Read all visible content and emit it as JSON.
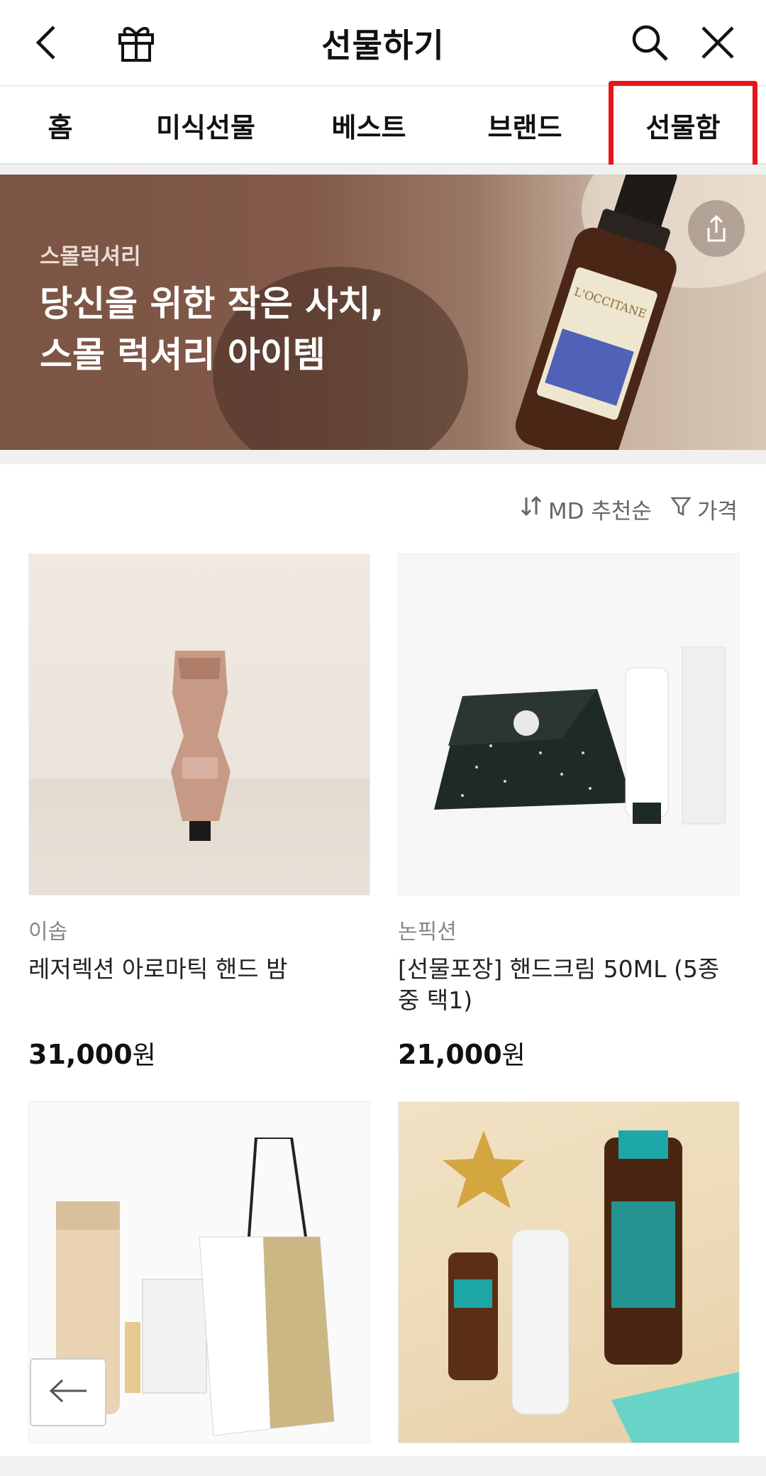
{
  "header": {
    "title": "선물하기",
    "back_icon": "chevron-left-icon",
    "gift_icon": "gift-icon",
    "search_icon": "search-icon",
    "close_icon": "close-icon"
  },
  "tabs": [
    {
      "label": "홈"
    },
    {
      "label": "미식선물"
    },
    {
      "label": "베스트"
    },
    {
      "label": "브랜드"
    },
    {
      "label": "선물함"
    }
  ],
  "highlight_color": "#e8161b",
  "banner": {
    "eyebrow": "스몰럭셔리",
    "headline": "당신을 위한 작은 사치,\n스몰 럭셔리 아이템",
    "product_label": "L'OCCITANE",
    "share_icon": "share-icon"
  },
  "sort": {
    "order_label": "MD 추천순",
    "order_icon": "sort-arrows-icon",
    "filter_label": "가격",
    "filter_icon": "filter-icon"
  },
  "products": [
    {
      "brand": "이솝",
      "name": "레저렉션 아로마틱 핸드 밤",
      "price": "31,000",
      "currency": "원"
    },
    {
      "brand": "논픽션",
      "name": "[선물포장] 핸드크림 50ML (5종 중 택1)",
      "price": "21,000",
      "currency": "원"
    },
    {
      "brand": "",
      "name": "",
      "price": "",
      "currency": ""
    },
    {
      "brand": "",
      "name": "",
      "price": "",
      "currency": ""
    }
  ],
  "floating": {
    "back_icon": "arrow-left-icon"
  }
}
